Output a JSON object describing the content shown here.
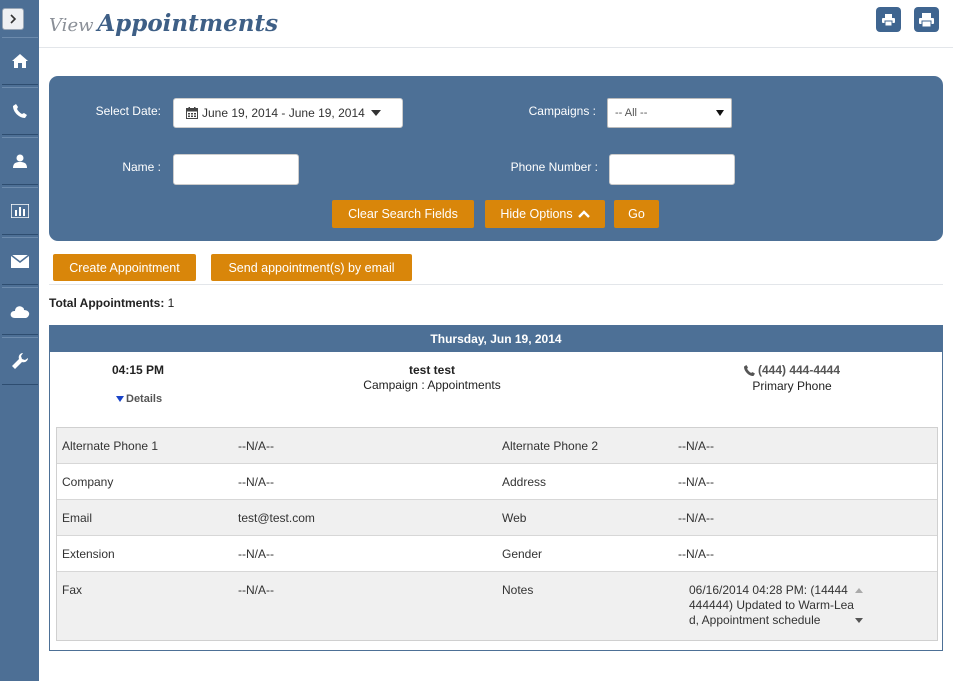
{
  "header": {
    "title_prefix": "View",
    "title_main": "Appointments"
  },
  "sidebar": {
    "toggle_icon": "chevron-right-icon",
    "items": [
      {
        "icon": "home-icon"
      },
      {
        "icon": "phone-icon"
      },
      {
        "icon": "user-icon"
      },
      {
        "icon": "bar-chart-icon"
      },
      {
        "icon": "envelope-icon"
      },
      {
        "icon": "cloud-icon"
      },
      {
        "icon": "wrench-icon"
      }
    ]
  },
  "filters": {
    "date_label": "Select Date:",
    "date_value": "June 19, 2014 - June 19, 2014",
    "campaigns_label": "Campaigns :",
    "campaigns_value": "-- All --",
    "name_label": "Name :",
    "name_value": "",
    "phone_label": "Phone Number :",
    "phone_value": "",
    "clear_label": "Clear Search Fields",
    "hide_label": "Hide Options",
    "go_label": "Go"
  },
  "actions": {
    "create_label": "Create Appointment",
    "send_label": "Send appointment(s) by email"
  },
  "total": {
    "label": "Total Appointments:",
    "count": "1"
  },
  "appointment": {
    "day_header": "Thursday, Jun 19, 2014",
    "time": "04:15 PM",
    "details_label": "Details",
    "name": "test test",
    "campaign": "Campaign : Appointments",
    "phone": "(444) 444-4444",
    "phone_type": "Primary Phone",
    "details": {
      "rows": [
        {
          "l1": "Alternate Phone 1",
          "v1": "--N/A--",
          "l2": "Alternate Phone 2",
          "v2": "--N/A--"
        },
        {
          "l1": "Company",
          "v1": "--N/A--",
          "l2": "Address",
          "v2": "--N/A--"
        },
        {
          "l1": "Email",
          "v1": "test@test.com",
          "l2": "Web",
          "v2": "--N/A--"
        },
        {
          "l1": "Extension",
          "v1": "--N/A--",
          "l2": "Gender",
          "v2": "--N/A--"
        }
      ],
      "fax_label": "Fax",
      "fax_value": "--N/A--",
      "notes_label": "Notes",
      "notes_value": "06/16/2014 04:28 PM: (14444444444) Updated to Warm-Lead, Appointment schedule"
    }
  },
  "colors": {
    "sidebar": "#4d6f95",
    "panel": "#4d7096",
    "accent": "#d9860a",
    "title": "#3e5f86"
  }
}
